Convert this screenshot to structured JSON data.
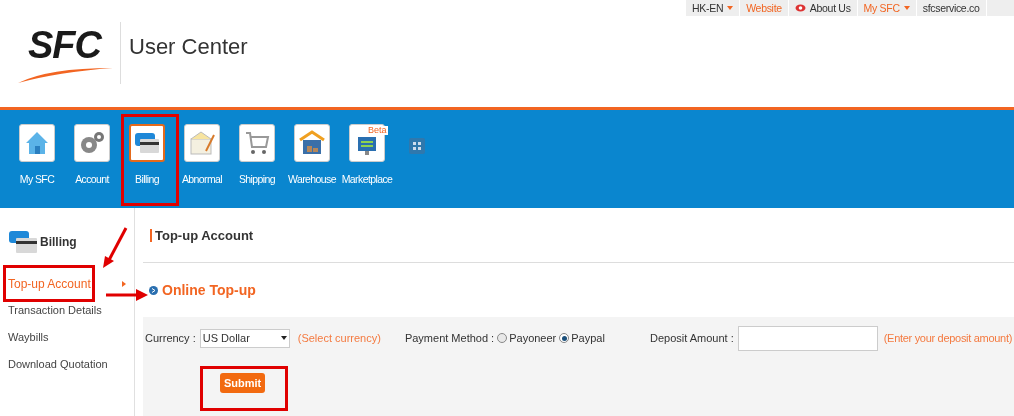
{
  "top_links": [
    {
      "label": "HK-EN",
      "highlighted": false,
      "has_menu": true,
      "kind": "plain"
    },
    {
      "label": "Website",
      "highlighted": true,
      "has_menu": false,
      "kind": "plain"
    },
    {
      "label": "About Us",
      "highlighted": false,
      "has_menu": false,
      "kind": "eye"
    },
    {
      "label": "My SFC",
      "highlighted": true,
      "has_menu": true,
      "kind": "plain"
    },
    {
      "label": "sfcservice.co",
      "highlighted": false,
      "has_menu": false,
      "kind": "plain"
    }
  ],
  "logo": {
    "text": "SFC",
    "subtitle": "User Center"
  },
  "nav": [
    {
      "label": "My SFC",
      "kind": "home",
      "selected": false
    },
    {
      "label": "Account",
      "kind": "gears",
      "selected": false
    },
    {
      "label": "Billing",
      "kind": "card",
      "selected": true
    },
    {
      "label": "Abnormal",
      "kind": "envelope",
      "selected": false
    },
    {
      "label": "Shipping",
      "kind": "cart",
      "selected": false
    },
    {
      "label": "Warehouse",
      "kind": "warehouse",
      "selected": false
    },
    {
      "label": "Marketplace",
      "kind": "monitor",
      "selected": false,
      "badge": "Beta"
    }
  ],
  "sidebar": {
    "title": "Billing",
    "items": [
      {
        "label": "Top-up Account",
        "selected": true
      },
      {
        "label": "Transaction Details",
        "selected": false
      },
      {
        "label": "Waybills",
        "selected": false
      },
      {
        "label": "Download Quotation",
        "selected": false
      }
    ]
  },
  "content": {
    "heading": "Top-up Account",
    "section": "Online Top-up",
    "form": {
      "currency_label": "Currency :",
      "currency_value": "US Dollar",
      "currency_hint": "(Select currency)",
      "payment_label": "Payment Method :",
      "payment_options": [
        {
          "label": "Payoneer",
          "selected": false
        },
        {
          "label": "Paypal",
          "selected": true
        }
      ],
      "deposit_label": "Deposit Amount :",
      "deposit_hint": "(Enter your deposit amount)",
      "submit": "Submit"
    }
  }
}
